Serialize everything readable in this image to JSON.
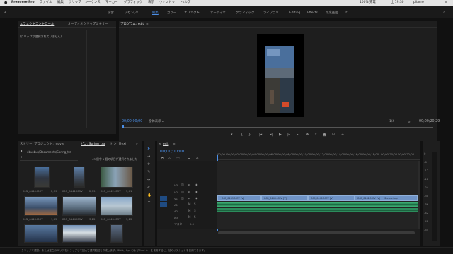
{
  "menubar": {
    "app": "Premiere Pro",
    "items": [
      "ファイル",
      "編集",
      "クリップ",
      "シーケンス",
      "マーカー",
      "グラフィック",
      "表示",
      "ウィンドウ",
      "ヘルプ"
    ],
    "status": "100% 充電",
    "time": "土 19:30",
    "user": "pilacro"
  },
  "workspaces": [
    "学習",
    "アセンブリ",
    "編集",
    "カラー",
    "エフェクト",
    "オーディオ",
    "グラフィック",
    "ライブラリ",
    "Editing",
    "Effects",
    "作業画面"
  ],
  "source_panel": {
    "tabs": [
      "エフェクトコントロール",
      "オーディオクリップミキサー"
    ],
    "empty_msg": "(クリップが選択されていません)"
  },
  "program": {
    "title": "プログラム: edit",
    "timecode_left": "00;00;00;00",
    "fit": "全体表示",
    "quality": "1/4",
    "timecode_right": "00;00;20;29"
  },
  "project": {
    "tabs": [
      "ストリー",
      "プロジェクト: movie",
      "ビン: Spring_tra",
      "ビン: Mexi"
    ],
    "path": "ebusbus/Documents/Spring_tra",
    "info": "43 個中 1 個の項目が選択されました",
    "items": [
      {
        "label": "IMG_0440.MOV",
        "dur": "2;19"
      },
      {
        "label": "IMG_0441.MOV",
        "dur": "2;19"
      },
      {
        "label": "IMG_0442.MOV",
        "dur": "5;01"
      },
      {
        "label": "IMG_0443.MOV",
        "dur": "1;05"
      },
      {
        "label": "IMG_0444.MOV",
        "dur": "3;22"
      },
      {
        "label": "IMG_0445.MOV",
        "dur": "3;22"
      },
      {
        "label": "IMG_0446.MOV",
        "dur": ""
      },
      {
        "label": "IMG_0447.MOV",
        "dur": ""
      },
      {
        "label": "IMG_0448.MOV",
        "dur": ""
      }
    ]
  },
  "timeline": {
    "tab": "edit",
    "timecode": "00;00;00;00",
    "ruler": [
      "00;00",
      "00;00;02;00",
      "00;00;04;00",
      "00;00;06;00",
      "00;00;08;00",
      "00;00;10;00",
      "00;00;12;00",
      "00;00;14;00",
      "00;00;16;00",
      "00;00;18;00",
      "00;00;20;00",
      "00;00;22;00"
    ],
    "tracks": [
      "V3",
      "V2",
      "V1",
      "A1",
      "A2",
      "A3"
    ],
    "master_label": "マスター",
    "master_value": "0.0",
    "clips": [
      "IMG_0439.MOV [V]",
      "IMG_0440.MOV [V]",
      "IMG_0441.MOV [V]",
      "IMG_0444.MOV [V]",
      "IMG_0442.MOV [V]",
      "IMG_0443.MOV [V]"
    ],
    "clip_end": "IMG_0442.MOV [V] ~ (Stereo-Lap)"
  },
  "statusbar": "クリックで選択、または空白のエリアをドラッグして囲んで選択範囲を作成します。Shift、Opt およびCmd キーを使用すると、他のオプションを使用できます。",
  "meter_labels": [
    "0",
    "-6",
    "-12",
    "-18",
    "-24",
    "-30",
    "-36",
    "-42",
    "-48",
    "-54"
  ],
  "colors": {
    "accent": "#4b8ee6",
    "clip_video": "#6f93c6",
    "clip_audio": "#2e9f67",
    "bg": "#1e1e1e"
  }
}
